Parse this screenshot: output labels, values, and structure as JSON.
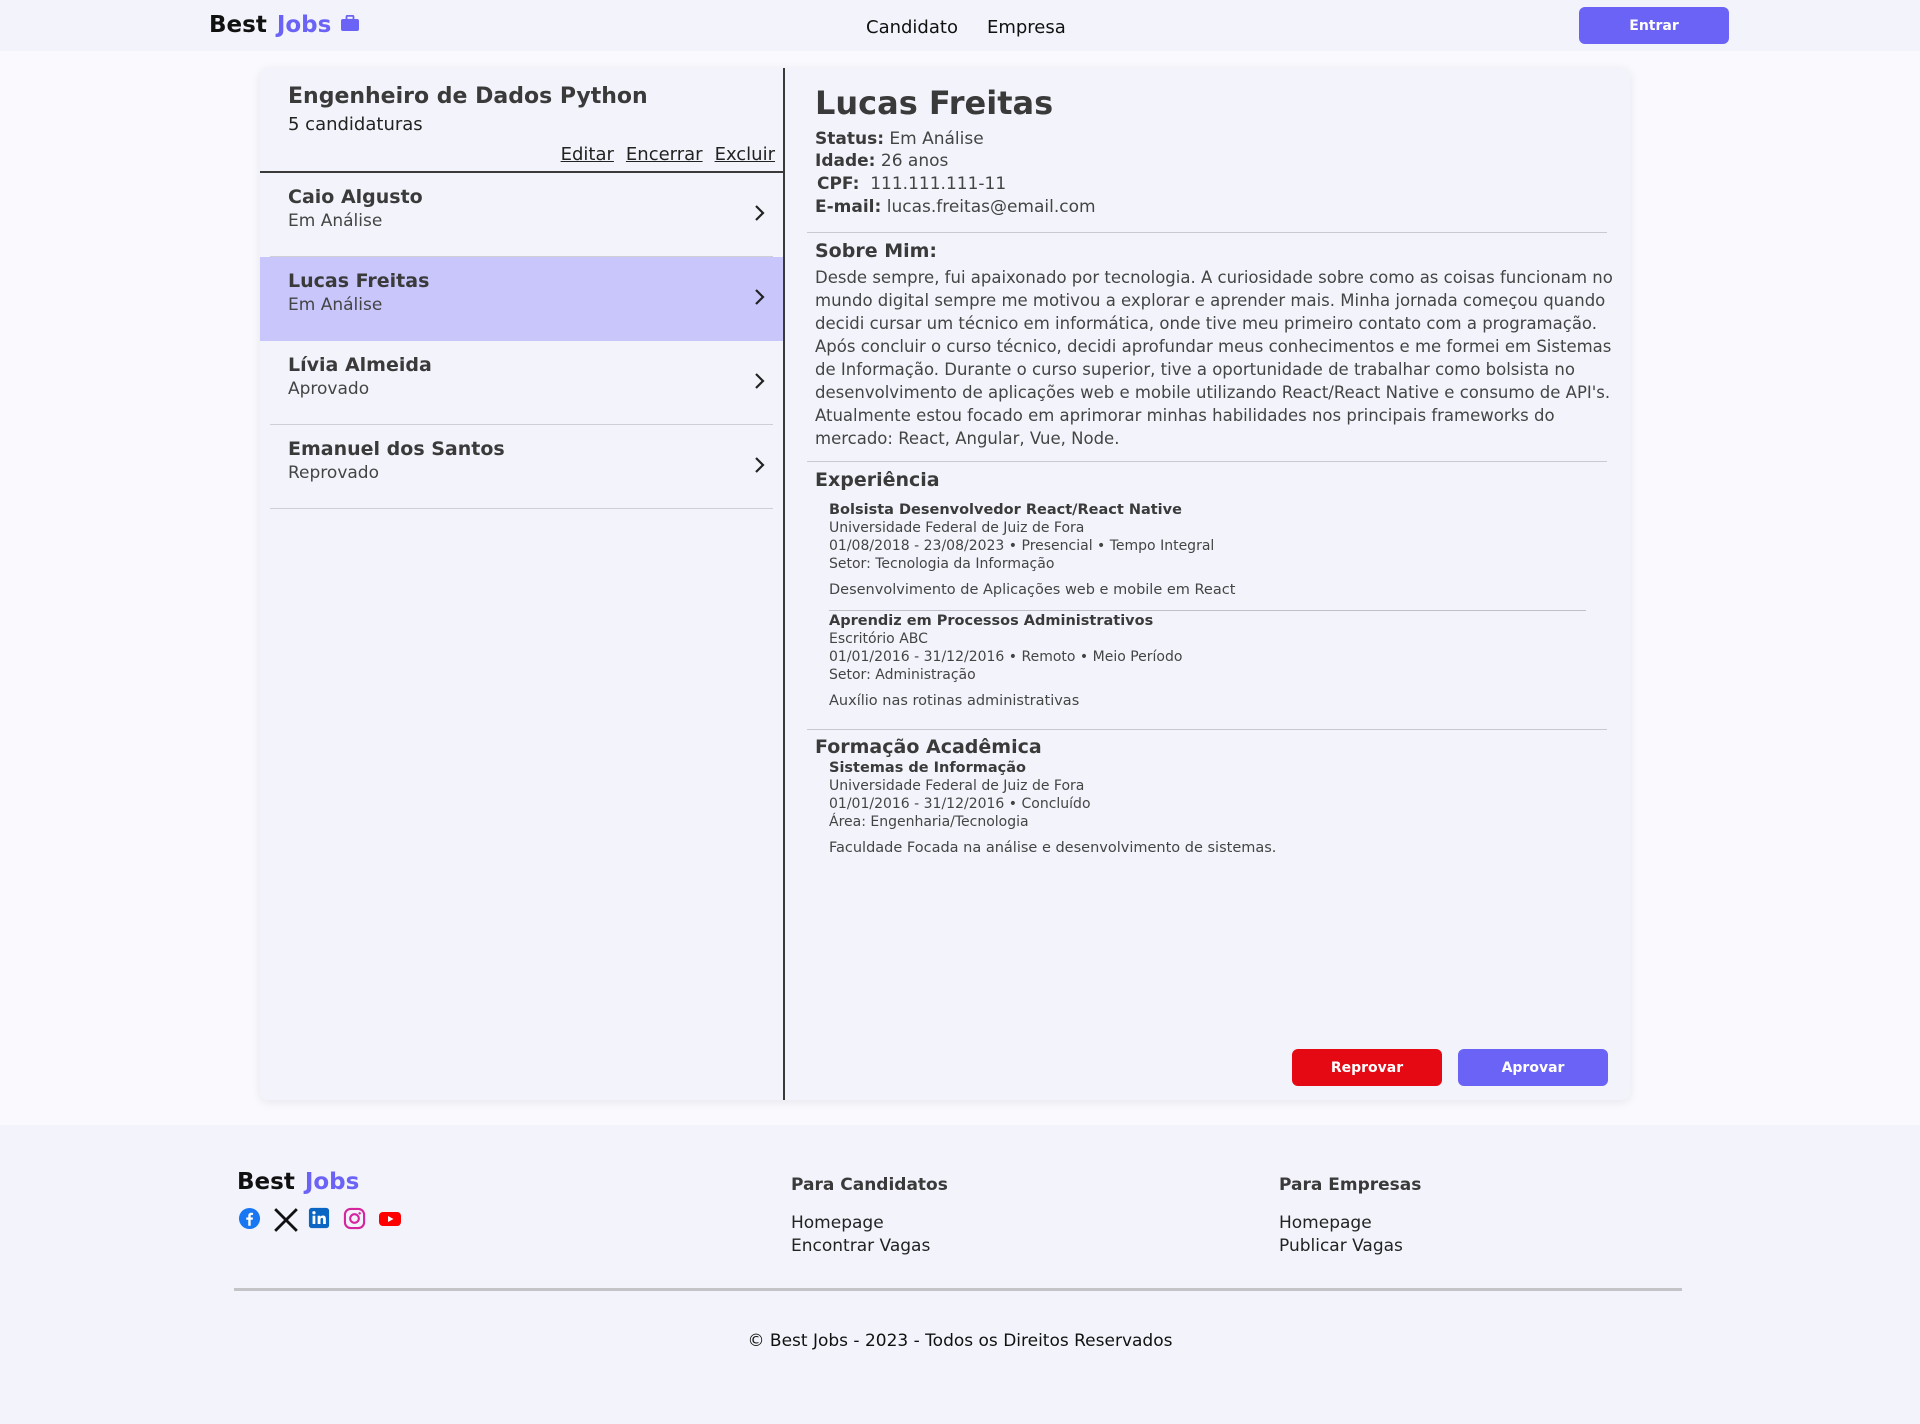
{
  "header": {
    "logo_word1": "Best",
    "logo_word2": "Jobs",
    "nav": [
      "Candidato",
      "Empresa"
    ],
    "login_label": "Entrar"
  },
  "job": {
    "title": "Engenheiro de Dados Python",
    "count": "5 candidaturas",
    "actions": [
      "Editar",
      "Encerrar",
      "Excluir"
    ]
  },
  "candidates": [
    {
      "name": "Caio Algusto",
      "status": "Em Análise"
    },
    {
      "name": "Lucas Freitas",
      "status": "Em Análise"
    },
    {
      "name": "Lívia Almeida",
      "status": "Aprovado"
    },
    {
      "name": "Emanuel dos Santos",
      "status": "Reprovado"
    }
  ],
  "selected": {
    "name": "Lucas Freitas",
    "status_label": "Status:",
    "status": "Em Análise",
    "age_label": "Idade:",
    "age": "26 anos",
    "cpf_label": "CPF:",
    "cpf": "111.111.111-11",
    "email_label": "E-mail:",
    "email": "lucas.freitas@email.com",
    "about_title": "Sobre Mim:",
    "about": "Desde sempre, fui apaixonado por tecnologia. A curiosidade sobre como as coisas funcionam no mundo digital sempre me motivou a explorar e aprender mais. Minha jornada começou quando decidi cursar um técnico em informática, onde tive meu primeiro contato com a programação. Após concluir o curso técnico, decidi aprofundar meus conhecimentos e me formei em Sistemas de Informação. Durante o curso superior, tive a oportunidade de trabalhar como bolsista no desenvolvimento de aplicações web e mobile utilizando React/React Native e consumo de API's. Atualmente estou focado em aprimorar minhas habilidades nos principais frameworks do mercado: React, Angular, Vue, Node.",
    "experience_title": "Experiência",
    "experiences": [
      {
        "title": "Bolsista Desenvolvedor React/React Native",
        "org": "Universidade Federal de Juiz de Fora",
        "period": "01/08/2018 - 23/08/2023 • Presencial • Tempo Integral",
        "sector": "Setor: Tecnologia da Informação",
        "desc": "Desenvolvimento de Aplicações web e mobile em React"
      },
      {
        "title": "Aprendiz em Processos Administrativos",
        "org": "Escritório ABC",
        "period": "01/01/2016 - 31/12/2016 • Remoto • Meio Período",
        "sector": "Setor: Administração",
        "desc": "Auxílio nas rotinas administrativas"
      }
    ],
    "education_title": "Formação Acadêmica",
    "education": {
      "title": "Sistemas de Informação",
      "org": "Universidade Federal de Juiz de Fora",
      "period": "01/01/2016 - 31/12/2016 • Concluído",
      "area": "Área: Engenharia/Tecnologia",
      "desc": "Faculdade Focada na análise e desenvolvimento de sistemas."
    },
    "reject_label": "Reprovar",
    "approve_label": "Aprovar"
  },
  "footer": {
    "logo_word1": "Best",
    "logo_word2": "Jobs",
    "socials": [
      "facebook-icon",
      "x-icon",
      "linkedin-icon",
      "instagram-icon",
      "youtube-icon"
    ],
    "candidates_title": "Para Candidatos",
    "candidates_links": [
      "Homepage",
      "Encontrar Vagas"
    ],
    "companies_title": "Para Empresas",
    "companies_links": [
      "Homepage",
      "Publicar Vagas"
    ],
    "copyright": "© Best Jobs - 2023 - Todos os Direitos Reservados"
  },
  "colors": {
    "accent": "#6b63f5",
    "danger": "#e50914",
    "selected_row": "#c8c6fb"
  }
}
